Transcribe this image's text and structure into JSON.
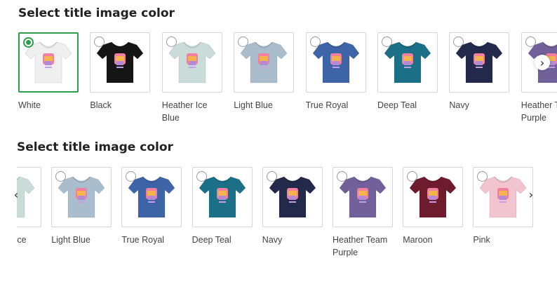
{
  "sections": [
    {
      "heading": "Select title image color",
      "selected": "White",
      "options": [
        {
          "label": "White",
          "color": "#efefef"
        },
        {
          "label": "Black",
          "color": "#151515"
        },
        {
          "label": "Heather Ice Blue",
          "color": "#c9dcda"
        },
        {
          "label": "Light Blue",
          "color": "#a9bdcd"
        },
        {
          "label": "True Royal",
          "color": "#3e64a8"
        },
        {
          "label": "Deep Teal",
          "color": "#1b6f86"
        },
        {
          "label": "Navy",
          "color": "#23294a"
        },
        {
          "label": "Heather Team Purple",
          "color": "#72609a"
        }
      ],
      "next_icon": "chevron-right-icon"
    },
    {
      "heading": "Select title image color",
      "options": [
        {
          "label": "Heather Ice Blue",
          "color": "#c9dcda"
        },
        {
          "label": "Light Blue",
          "color": "#a9bdcd"
        },
        {
          "label": "True Royal",
          "color": "#3e64a8"
        },
        {
          "label": "Deep Teal",
          "color": "#1b6f86"
        },
        {
          "label": "Navy",
          "color": "#23294a"
        },
        {
          "label": "Heather Team Purple",
          "color": "#72609a"
        },
        {
          "label": "Maroon",
          "color": "#6e1b2e"
        },
        {
          "label": "Pink",
          "color": "#f2c4cf"
        }
      ],
      "prev_icon": "chevron-left-icon",
      "next_icon": "chevron-right-icon"
    }
  ],
  "accent": "#2e9e4a",
  "icons": {
    "prev": "‹",
    "next": "›"
  }
}
